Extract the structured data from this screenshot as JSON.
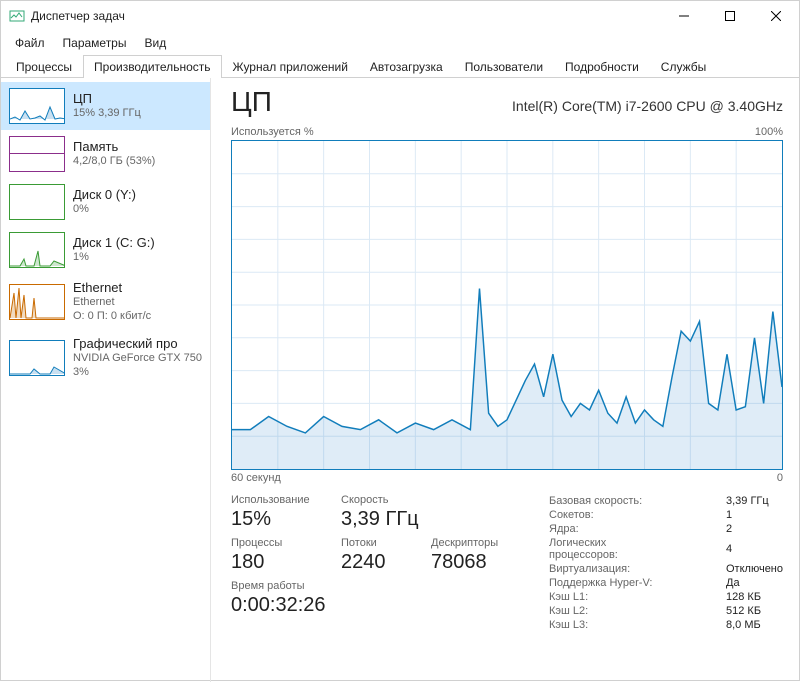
{
  "window": {
    "title": "Диспетчер задач"
  },
  "menu": {
    "file": "Файл",
    "options": "Параметры",
    "view": "Вид"
  },
  "tabs": {
    "processes": "Процессы",
    "performance": "Производительность",
    "apphistory": "Журнал приложений",
    "startup": "Автозагрузка",
    "users": "Пользователи",
    "details": "Подробности",
    "services": "Службы"
  },
  "sidebar": {
    "cpu": {
      "title": "ЦП",
      "sub": "15% 3,39 ГГц"
    },
    "mem": {
      "title": "Память",
      "sub": "4,2/8,0 ГБ (53%)"
    },
    "disk0": {
      "title": "Диск 0 (Y:)",
      "sub": "0%"
    },
    "disk1": {
      "title": "Диск 1 (C: G:)",
      "sub": "1%"
    },
    "eth": {
      "title": "Ethernet",
      "sub": "Ethernet",
      "sub2": "О: 0 П: 0 кбит/с"
    },
    "gpu": {
      "title": "Графический про",
      "sub": "NVIDIA GeForce GTX 750",
      "sub2": "3%"
    }
  },
  "main": {
    "title": "ЦП",
    "cpu_name": "Intel(R) Core(TM) i7-2600 CPU @ 3.40GHz",
    "axis_top_left": "Используется %",
    "axis_top_right": "100%",
    "axis_bottom_left": "60 секунд",
    "axis_bottom_right": "0"
  },
  "stats_left": {
    "usage_label": "Использование",
    "usage_value": "15%",
    "speed_label": "Скорость",
    "speed_value": "3,39 ГГц",
    "procs_label": "Процессы",
    "procs_value": "180",
    "threads_label": "Потоки",
    "threads_value": "2240",
    "handles_label": "Дескрипторы",
    "handles_value": "78068",
    "uptime_label": "Время работы",
    "uptime_value": "0:00:32:26"
  },
  "stats_right": {
    "base_speed_k": "Базовая скорость:",
    "base_speed_v": "3,39 ГГц",
    "sockets_k": "Сокетов:",
    "sockets_v": "1",
    "cores_k": "Ядра:",
    "cores_v": "2",
    "lprocs_k": "Логических процессоров:",
    "lprocs_v": "4",
    "virt_k": "Виртуализация:",
    "virt_v": "Отключено",
    "hyperv_k": "Поддержка Hyper-V:",
    "hyperv_v": "Да",
    "l1_k": "Кэш L1:",
    "l1_v": "128 КБ",
    "l2_k": "Кэш L2:",
    "l2_v": "512 КБ",
    "l3_k": "Кэш L3:",
    "l3_v": "8,0 МБ"
  },
  "chart_data": {
    "type": "area",
    "title": "ЦП — Используется %",
    "xlabel": "секунды",
    "ylabel": "%",
    "xlim": [
      60,
      0
    ],
    "ylim": [
      0,
      100
    ],
    "x": [
      60,
      58,
      56,
      54,
      52,
      50,
      48,
      46,
      44,
      42,
      40,
      38,
      36,
      34,
      33,
      32,
      31,
      30,
      28,
      27,
      26,
      25,
      24,
      23,
      22,
      21,
      20,
      19,
      18,
      17,
      16,
      15,
      14,
      13,
      12,
      11,
      10,
      9,
      8,
      7,
      6,
      5,
      4,
      3,
      2,
      1,
      0
    ],
    "values": [
      12,
      12,
      16,
      13,
      11,
      16,
      13,
      12,
      15,
      11,
      14,
      12,
      15,
      12,
      55,
      17,
      13,
      15,
      27,
      32,
      22,
      35,
      21,
      16,
      20,
      18,
      24,
      17,
      14,
      22,
      14,
      18,
      15,
      13,
      28,
      42,
      39,
      45,
      20,
      18,
      35,
      18,
      19,
      40,
      20,
      48,
      25
    ]
  }
}
